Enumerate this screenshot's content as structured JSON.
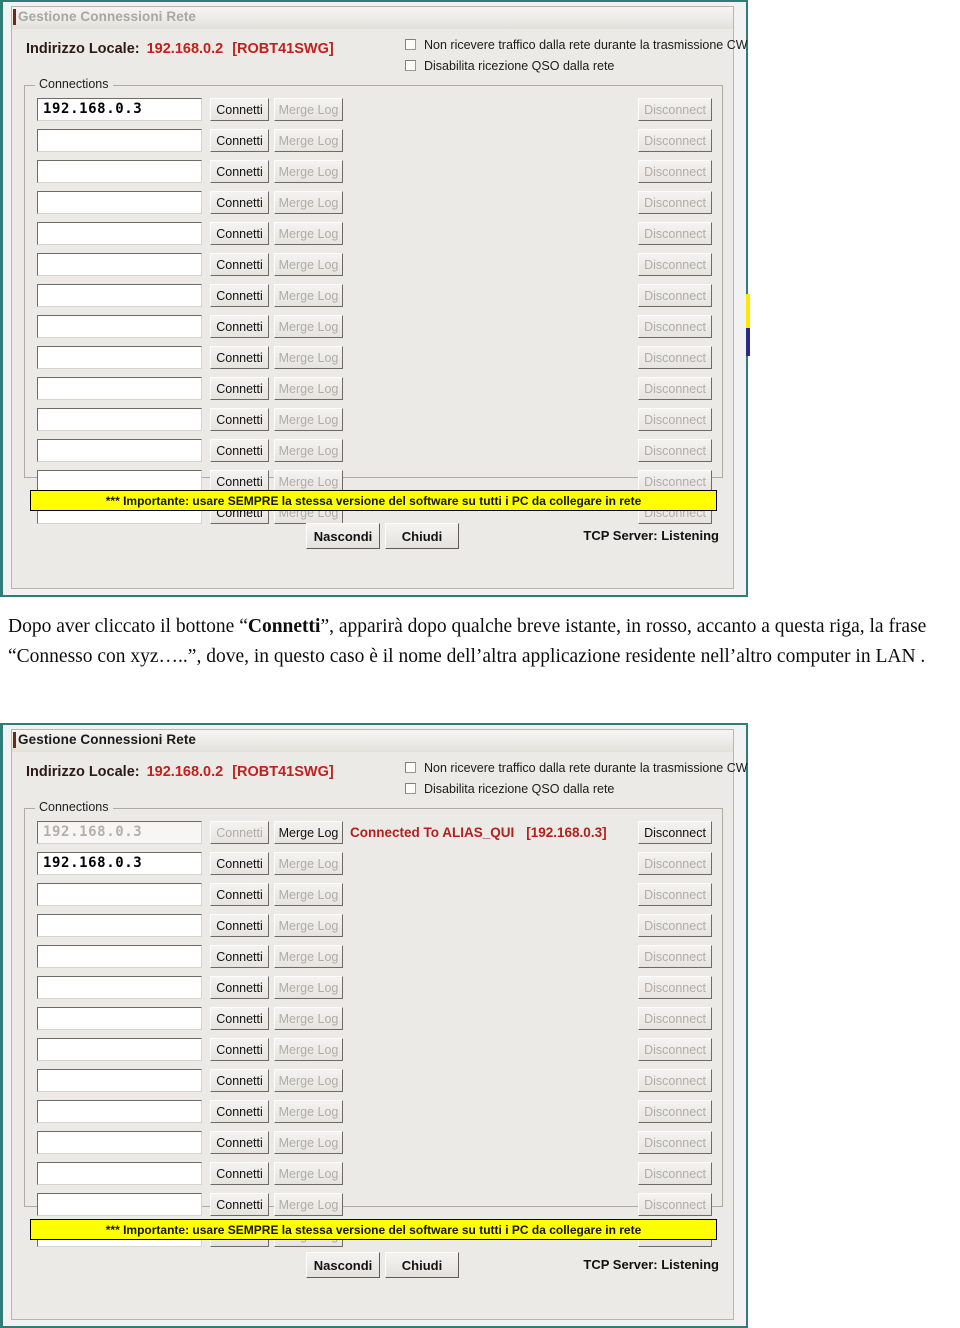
{
  "page": {
    "caption_part1": "Dopo aver cliccato il bottone “",
    "caption_bold": "Connetti",
    "caption_part2": "”, apparirà dopo qualche breve istante, in rosso, accanto a questa riga, la frase “Connesso con xyz…..”,  dove, in questo caso è il nome dell’altra applicazione residente nell’altro computer in LAN ."
  },
  "dialog_top": {
    "title": "Gestione Connessioni Rete",
    "title_state": "inactive",
    "local_address": {
      "label": "Indirizzo Locale:",
      "ip": "192.168.0.2",
      "host": "[ROBT41SWG]"
    },
    "checkboxes": [
      {
        "label": "Non ricevere traffico dalla rete durante la trasmissione CW",
        "checked": false
      },
      {
        "label": "Disabilita ricezione QSO dalla rete",
        "checked": false
      }
    ],
    "group_title": "Connections",
    "buttons": {
      "connect": "Connetti",
      "merge_log": "Merge Log",
      "disconnect": "Disconnect"
    },
    "rows": [
      {
        "ip": "192.168.0.3",
        "ip_dim": false,
        "connect_enabled": true,
        "merge_enabled": false,
        "disconnect_enabled": false,
        "status": ""
      },
      {
        "ip": "",
        "ip_dim": false,
        "connect_enabled": true,
        "merge_enabled": false,
        "disconnect_enabled": false,
        "status": ""
      },
      {
        "ip": "",
        "ip_dim": false,
        "connect_enabled": true,
        "merge_enabled": false,
        "disconnect_enabled": false,
        "status": ""
      },
      {
        "ip": "",
        "ip_dim": false,
        "connect_enabled": true,
        "merge_enabled": false,
        "disconnect_enabled": false,
        "status": ""
      },
      {
        "ip": "",
        "ip_dim": false,
        "connect_enabled": true,
        "merge_enabled": false,
        "disconnect_enabled": false,
        "status": ""
      },
      {
        "ip": "",
        "ip_dim": false,
        "connect_enabled": true,
        "merge_enabled": false,
        "disconnect_enabled": false,
        "status": ""
      },
      {
        "ip": "",
        "ip_dim": false,
        "connect_enabled": true,
        "merge_enabled": false,
        "disconnect_enabled": false,
        "status": ""
      },
      {
        "ip": "",
        "ip_dim": false,
        "connect_enabled": true,
        "merge_enabled": false,
        "disconnect_enabled": false,
        "status": ""
      },
      {
        "ip": "",
        "ip_dim": false,
        "connect_enabled": true,
        "merge_enabled": false,
        "disconnect_enabled": false,
        "status": ""
      },
      {
        "ip": "",
        "ip_dim": false,
        "connect_enabled": true,
        "merge_enabled": false,
        "disconnect_enabled": false,
        "status": ""
      },
      {
        "ip": "",
        "ip_dim": false,
        "connect_enabled": true,
        "merge_enabled": false,
        "disconnect_enabled": false,
        "status": ""
      },
      {
        "ip": "",
        "ip_dim": false,
        "connect_enabled": true,
        "merge_enabled": false,
        "disconnect_enabled": false,
        "status": ""
      },
      {
        "ip": "",
        "ip_dim": false,
        "connect_enabled": true,
        "merge_enabled": false,
        "disconnect_enabled": false,
        "status": ""
      },
      {
        "ip": "",
        "ip_dim": false,
        "connect_enabled": true,
        "merge_enabled": false,
        "disconnect_enabled": false,
        "status": ""
      }
    ],
    "warning": "*** Importante: usare SEMPRE la stessa versione del software su tutti i PC da collegare in rete",
    "footer": {
      "hide": "Nascondi",
      "close": "Chiudi",
      "tcp_status": "TCP Server: Listening"
    }
  },
  "dialog_bottom": {
    "title": "Gestione Connessioni Rete",
    "title_state": "active",
    "local_address": {
      "label": "Indirizzo Locale:",
      "ip": "192.168.0.2",
      "host": "[ROBT41SWG]"
    },
    "checkboxes": [
      {
        "label": "Non ricevere traffico dalla rete durante la trasmissione CW",
        "checked": false
      },
      {
        "label": "Disabilita ricezione QSO dalla rete",
        "checked": false
      }
    ],
    "group_title": "Connections",
    "buttons": {
      "connect": "Connetti",
      "merge_log": "Merge Log",
      "disconnect": "Disconnect"
    },
    "rows": [
      {
        "ip": "192.168.0.3",
        "ip_dim": true,
        "connect_enabled": false,
        "merge_enabled": true,
        "disconnect_enabled": true,
        "status": "Connected To ALIAS_QUI",
        "status_ip": "[192.168.0.3]"
      },
      {
        "ip": "192.168.0.3",
        "ip_dim": false,
        "connect_enabled": true,
        "merge_enabled": false,
        "disconnect_enabled": false,
        "status": ""
      },
      {
        "ip": "",
        "ip_dim": false,
        "connect_enabled": true,
        "merge_enabled": false,
        "disconnect_enabled": false,
        "status": ""
      },
      {
        "ip": "",
        "ip_dim": false,
        "connect_enabled": true,
        "merge_enabled": false,
        "disconnect_enabled": false,
        "status": ""
      },
      {
        "ip": "",
        "ip_dim": false,
        "connect_enabled": true,
        "merge_enabled": false,
        "disconnect_enabled": false,
        "status": ""
      },
      {
        "ip": "",
        "ip_dim": false,
        "connect_enabled": true,
        "merge_enabled": false,
        "disconnect_enabled": false,
        "status": ""
      },
      {
        "ip": "",
        "ip_dim": false,
        "connect_enabled": true,
        "merge_enabled": false,
        "disconnect_enabled": false,
        "status": ""
      },
      {
        "ip": "",
        "ip_dim": false,
        "connect_enabled": true,
        "merge_enabled": false,
        "disconnect_enabled": false,
        "status": ""
      },
      {
        "ip": "",
        "ip_dim": false,
        "connect_enabled": true,
        "merge_enabled": false,
        "disconnect_enabled": false,
        "status": ""
      },
      {
        "ip": "",
        "ip_dim": false,
        "connect_enabled": true,
        "merge_enabled": false,
        "disconnect_enabled": false,
        "status": ""
      },
      {
        "ip": "",
        "ip_dim": false,
        "connect_enabled": true,
        "merge_enabled": false,
        "disconnect_enabled": false,
        "status": ""
      },
      {
        "ip": "",
        "ip_dim": false,
        "connect_enabled": true,
        "merge_enabled": false,
        "disconnect_enabled": false,
        "status": ""
      },
      {
        "ip": "",
        "ip_dim": false,
        "connect_enabled": true,
        "merge_enabled": false,
        "disconnect_enabled": false,
        "status": ""
      },
      {
        "ip": "",
        "ip_dim": false,
        "connect_enabled": true,
        "merge_enabled": false,
        "disconnect_enabled": false,
        "status": ""
      }
    ],
    "warning": "*** Importante: usare SEMPRE la stessa versione del software su tutti i PC da collegare in rete",
    "footer": {
      "hide": "Nascondi",
      "close": "Chiudi",
      "tcp_status": "TCP Server: Listening"
    }
  },
  "colors": {
    "accent_red": "#c0211c",
    "status_red": "#b41f1c",
    "warning_bg": "#ffff00",
    "frame_teal": "#2f7d76",
    "dialog_bg": "#eceae6"
  }
}
